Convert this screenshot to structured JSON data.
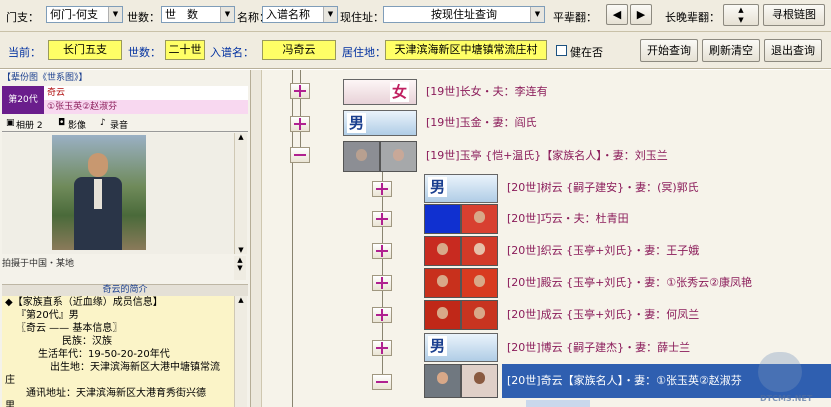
{
  "toolbar1": {
    "branch_label": "门支：",
    "branch_value": "何门-何支",
    "gen_label": "世数：",
    "gen_value": "世　数",
    "name_label": "名称：",
    "name_value": "入谱名称",
    "addr_label": "现住址：",
    "addr_value": "按现住址查询",
    "peer_label": "平辈翻：",
    "elder_label": "长晚辈翻：",
    "find_btn": "寻根链图"
  },
  "toolbar2": {
    "current_label": "当前：",
    "current_value": "长门五支",
    "gen_label": "世数：",
    "gen_value": "二十世",
    "pname_label": "入谱名：",
    "pname_value": "冯奇云",
    "home_label": "居住地：",
    "home_value": "天津滨海新区中塘镇常流庄村",
    "alive_label": "健在否",
    "start_btn": "开始查询",
    "refresh_btn": "刷新清空",
    "exit_btn": "退出查询"
  },
  "left": {
    "header": "【辈份图《世系图》】",
    "gen_badge": "第20代",
    "person_name": "奇云",
    "spouses": "①张玉英②赵淑芬",
    "tabs": [
      "相册 2",
      "影像",
      "录音"
    ],
    "photo_caption": "拍摄于中国・某地",
    "intro_title": "奇云的简介",
    "intro_lines": [
      "◆【家族直系（近血缘）成员信息】",
      "『第20代』男",
      "〖奇云 —— 基本信息〗",
      "民族：汉族",
      "生活年代：19-50-20-20年代",
      "出生地：天津滨海新区大港中塘镇常流",
      "庄",
      "通讯地址：天津滨海新区大港育秀街兴德",
      "里"
    ]
  },
  "tree": {
    "nodes": [
      {
        "text": "[19世]长女・夫：李连有",
        "photo": "female"
      },
      {
        "text": "[19世]玉金・妻：阎氏",
        "photo": "male"
      },
      {
        "text": "[19世]玉亭 {恺+温氏}【家族名人】・妻：刘玉兰",
        "photo": "couple"
      },
      {
        "text": "[20世]树云 {嗣子建安}・妻：(冥)郭氏",
        "photo": "male"
      },
      {
        "text": "[20世]巧云・夫：杜青田",
        "photo": "couple"
      },
      {
        "text": "[20世]织云 {玉亭+刘氏}・妻：王子娥",
        "photo": "couple"
      },
      {
        "text": "[20世]殿云 {玉亭+刘氏}・妻：①张秀云②康凤艳",
        "photo": "couple"
      },
      {
        "text": "[20世]成云 {玉亭+刘氏}・妻：何凤兰",
        "photo": "couple"
      },
      {
        "text": "[20世]博云 {嗣子建杰}・妻：薛士兰",
        "photo": "male"
      },
      {
        "text": "[20世]奇云【家族名人】・妻：①张玉英②赵淑芬",
        "photo": "couple"
      }
    ],
    "male_char": "男",
    "female_char": "女"
  },
  "watermark": {
    "text": "DTCMS.NET"
  },
  "colors": {
    "accent_text": "#8b1c5a",
    "selected_bg": "#2f5fb0",
    "yellow_field": "#ffff66"
  }
}
